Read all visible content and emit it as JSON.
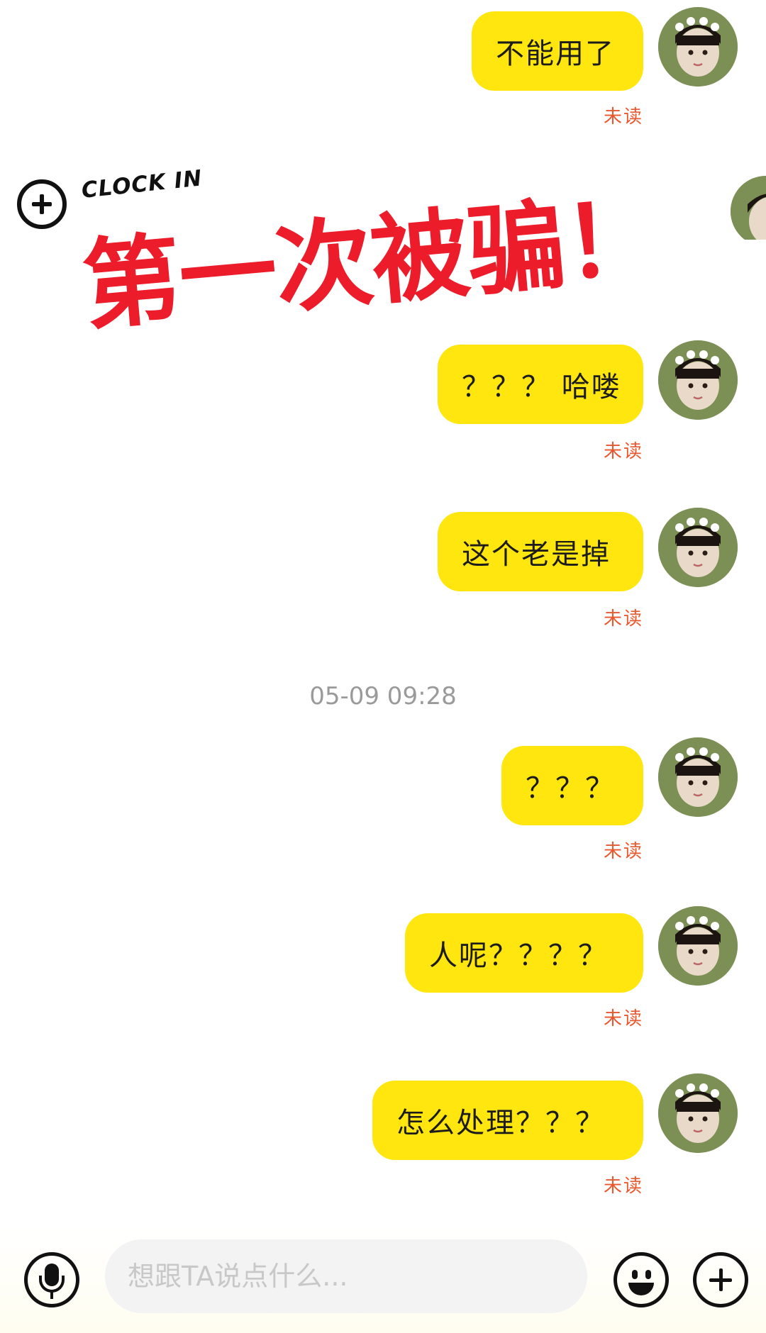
{
  "messages": [
    {
      "text": "不能用了",
      "status": "未读"
    },
    {
      "text": "？？？ 哈喽",
      "status": "未读"
    },
    {
      "text": "这个老是掉",
      "status": "未读"
    },
    {
      "text": "？？？",
      "status": "未读"
    },
    {
      "text": "人呢？？？？",
      "status": "未读"
    },
    {
      "text": "怎么处理？？？",
      "status": "未读"
    }
  ],
  "timestamp": "05-09 09:28",
  "overlay": {
    "tag": "CLOCK IN",
    "headline": "第一次被骗！"
  },
  "input": {
    "placeholder": "想跟TA说点什么..."
  },
  "icons": {
    "mic": "microphone-icon",
    "emoji": "emoji-icon",
    "plus": "plus-icon",
    "clock_in_plus": "plus-circle-icon"
  },
  "colors": {
    "bubble": "#FFE60F",
    "unread": "#E8582F",
    "headline": "#EC1C2A"
  }
}
